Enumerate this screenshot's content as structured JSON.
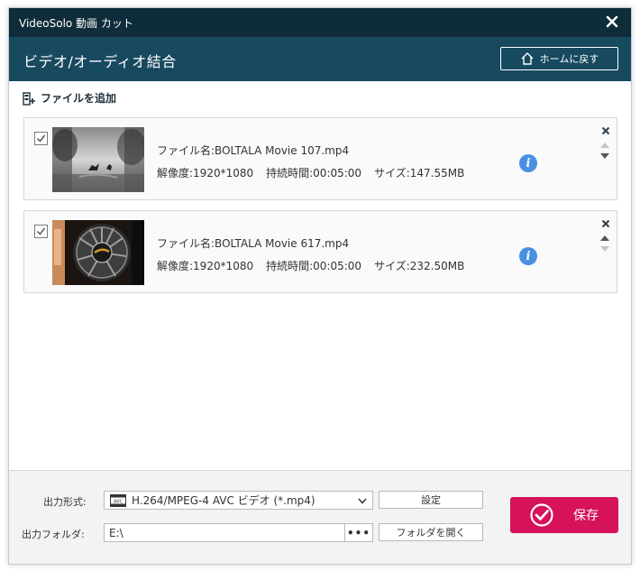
{
  "window": {
    "title": "VideoSolo 動画 カット",
    "heading": "ビデオ/オーディオ結合",
    "home_button": "ホームに戻す"
  },
  "toolbar": {
    "add_file": "ファイルを追加"
  },
  "files": [
    {
      "checked": true,
      "name": "ファイル名:BOLTALA Movie 107.mp4",
      "resolution": "解像度:1920*1080",
      "duration": "持続時間:00:05:00",
      "size": "サイズ:147.55MB"
    },
    {
      "checked": true,
      "name": "ファイル名:BOLTALA Movie 617.mp4",
      "resolution": "解像度:1920*1080",
      "duration": "持続時間:00:05:00",
      "size": "サイズ:232.50MB"
    }
  ],
  "output": {
    "format_label": "出力形式:",
    "format_value": "H.264/MPEG-4 AVC ビデオ (*.mp4)",
    "format_icon_text": "AVC",
    "settings_button": "設定",
    "folder_label": "出力フォルダ:",
    "folder_value": "E:\\",
    "browse_button": "•••",
    "open_folder_button": "フォルダを開く",
    "save_button": "保存"
  },
  "colors": {
    "titlebar": "#0f2c3a",
    "header": "#17495f",
    "accent_save": "#d6125a",
    "info_icon": "#4a90e2"
  },
  "icons": {
    "close": "close-icon",
    "home": "home-icon",
    "add_file": "add-file-icon",
    "info": "info-icon",
    "remove": "remove-icon",
    "move_up": "move-up-icon",
    "move_down": "move-down-icon",
    "dropdown": "chevron-down-icon",
    "save": "check-circle-icon"
  }
}
